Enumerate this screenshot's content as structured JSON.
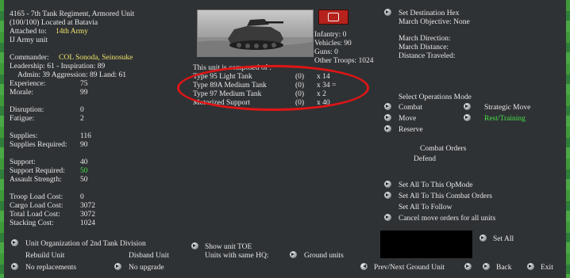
{
  "unit": {
    "title": "4165 - 7th Tank Regiment, Armored Unit",
    "location": "(100/100) Located at Batavia",
    "attached_label": "Attached to:",
    "attached_value": "14th Army",
    "service": "IJ Army unit"
  },
  "leader": {
    "commander_label": "Commander:",
    "commander_value": "COL Sonoda, Seinosuke",
    "line1": "Leadership: 61 - Inspiration: 89",
    "line2": "Admin: 39  Aggression: 89  Land: 61"
  },
  "stats": [
    {
      "label": "Experience:",
      "value": "75"
    },
    {
      "label": "Morale:",
      "value": "99"
    },
    {
      "label": "Disruption:",
      "value": "0"
    },
    {
      "label": "Fatigue:",
      "value": "2"
    },
    {
      "label": "Supplies:",
      "value": "116"
    },
    {
      "label": "Supplies Required:",
      "value": "90"
    },
    {
      "label": "Support:",
      "value": "40"
    },
    {
      "label": "Support Required:",
      "value": "50"
    },
    {
      "label": "Assault Strength:",
      "value": "50"
    },
    {
      "label": "Troop Load Cost:",
      "value": "0"
    },
    {
      "label": "Cargo Load Cost:",
      "value": "3072"
    },
    {
      "label": "Total Load Cost:",
      "value": "3072"
    },
    {
      "label": "Stacking Cost:",
      "value": "1024"
    }
  ],
  "troops": [
    {
      "label": "Infantry:",
      "value": "0"
    },
    {
      "label": "Vehicles:",
      "value": "90"
    },
    {
      "label": "Guns:",
      "value": "0"
    },
    {
      "label": "Other Troops:",
      "value": "1024"
    }
  ],
  "composition": {
    "heading": "This unit is composed of :",
    "rows": [
      {
        "name": "Type 95 Light Tank",
        "reserve": "(0)",
        "count": "x 14"
      },
      {
        "name": "Type 89A Medium Tank",
        "reserve": "(0)",
        "count": "x 34 ="
      },
      {
        "name": "Type 97 Medium Tank",
        "reserve": "(0)",
        "count": "x 2"
      },
      {
        "name": "Motorized Support",
        "reserve": "(0)",
        "count": "x 40"
      }
    ]
  },
  "destination": {
    "button": "Set Destination Hex",
    "objective": "March Objective: None",
    "direction": "March Direction:",
    "distance": "March Distance:",
    "traveled": "Distance Traveled:"
  },
  "opmode": {
    "heading": "Select Operations Mode",
    "combat": "Combat",
    "strategic": "Strategic Move",
    "move": "Move",
    "rest": "Rest/Training",
    "reserve": "Reserve",
    "orders_heading": "Combat Orders",
    "orders_value": "Defend"
  },
  "setall": {
    "opmode": "Set All To This OpMode",
    "combat_orders": "Set All To This Combat Orders",
    "follow": "Set All To Follow",
    "cancel": "Cancel move orders for all units"
  },
  "bottom": {
    "org": "Unit Organization of 2nd Tank Division",
    "rebuild": "Rebuild Unit",
    "disband": "Disband Unit",
    "no_replacements": "No replacements",
    "no_upgrade": "No upgrade",
    "show_toe": "Show unit TOE",
    "same_hq": "Units with same HQ:",
    "ground_units": "Ground units",
    "set_all": "Set All",
    "prev_next": "Prev/Next Ground Unit",
    "back": "Back",
    "exit": "Exit"
  },
  "colors": {
    "accent_yellow": "#f0e36a",
    "highlight_green": "#48e048",
    "annotation_red": "#e01515"
  },
  "icons": [
    "tank-photo",
    "tv-icon",
    "arrow-button-icon"
  ]
}
